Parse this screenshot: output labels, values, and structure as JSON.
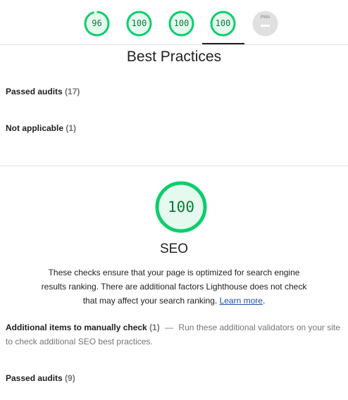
{
  "header": {
    "gauges": [
      {
        "name": "performance",
        "score": "96",
        "fraction": 0.96,
        "color": "#0cce6b"
      },
      {
        "name": "accessibility",
        "score": "100",
        "fraction": 1.0,
        "color": "#0cce6b"
      },
      {
        "name": "best-practices",
        "score": "100",
        "fraction": 1.0,
        "color": "#0cce6b"
      },
      {
        "name": "seo",
        "score": "100",
        "fraction": 1.0,
        "color": "#0cce6b",
        "active": true
      },
      {
        "name": "pwa",
        "label": "PWA",
        "color": "#e0e0e0"
      }
    ]
  },
  "best_practices": {
    "title": "Best Practices",
    "passed_label": "Passed audits",
    "passed_count": "(17)",
    "not_applicable_label": "Not applicable",
    "not_applicable_count": "(1)"
  },
  "seo": {
    "score": "100",
    "fraction": 1.0,
    "title": "SEO",
    "description": "These checks ensure that your page is optimized for search engine results ranking. There are additional factors Lighthouse does not check that may affect your search ranking.",
    "learn_more": "Learn more",
    "manual_label": "Additional items to manually check",
    "manual_count": "(1)",
    "manual_separator": "—",
    "manual_description": "Run these additional validators on your site to check additional SEO best practices.",
    "passed_label": "Passed audits",
    "passed_count": "(9)"
  },
  "colors": {
    "pass": "#0cce6b",
    "pass_fill": "#e6f9ee",
    "pass_text": "#0a7a3a",
    "link": "#1a4ea8"
  }
}
